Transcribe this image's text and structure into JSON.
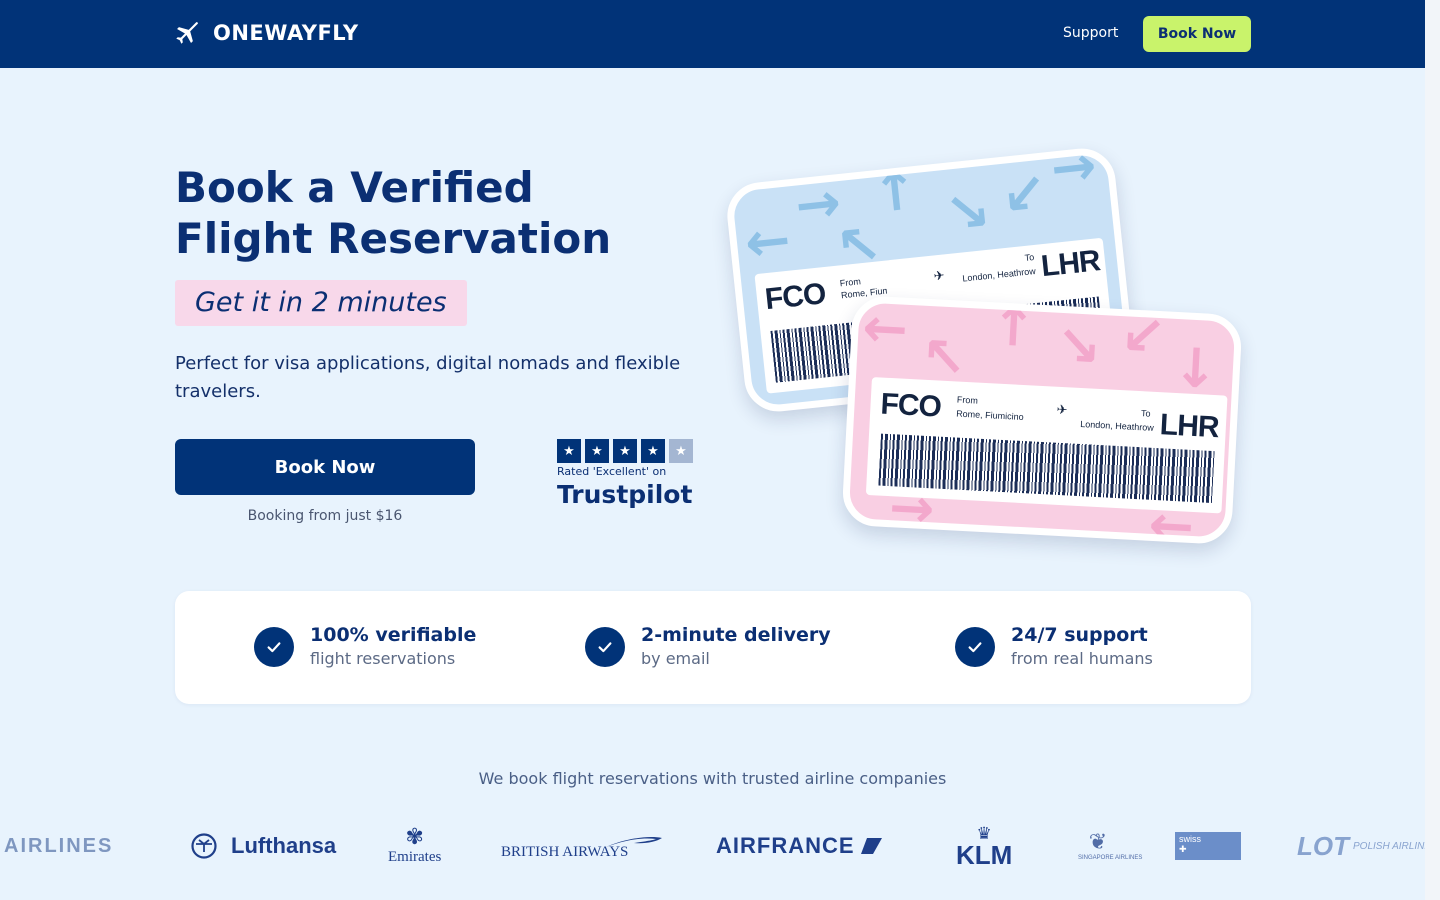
{
  "header": {
    "logo_text": "ONEWAYFLY",
    "nav_support": "Support",
    "nav_book": "Book Now"
  },
  "hero": {
    "title_line1": "Book a Verified",
    "title_line2": "Flight Reservation",
    "highlight": "Get it in 2 minutes",
    "subtitle": "Perfect for visa applications, digital nomads and flexible travelers.",
    "cta_label": "Book Now",
    "cta_note": "Booking from just $16"
  },
  "trustpilot": {
    "rating_filled": 4,
    "rating_total": 5,
    "rated_text": "Rated 'Excellent' on",
    "brand": "Trustpilot"
  },
  "tickets": [
    {
      "from_code": "FCO",
      "from_label": "From",
      "from_city": "Rome, Fiumicino",
      "to_code": "LHR",
      "to_label": "To",
      "to_city": "London, Heathrow",
      "color": "#c9e1f6"
    },
    {
      "from_code": "FCO",
      "from_label": "From",
      "from_city": "Rome, Fiumicino",
      "to_code": "LHR",
      "to_label": "To",
      "to_city": "London, Heathrow",
      "color": "#f9cfe3"
    }
  ],
  "features": [
    {
      "title": "100% verifiable",
      "subtitle": "flight reservations"
    },
    {
      "title": "2-minute delivery",
      "subtitle": "by email"
    },
    {
      "title": "24/7 support",
      "subtitle": "from real humans"
    }
  ],
  "airlines": {
    "title": "We book flight reservations with trusted airline companies",
    "logos": [
      {
        "name": "AIRLINES"
      },
      {
        "name": "Lufthansa"
      },
      {
        "name": "Emirates"
      },
      {
        "name": "BRITISH AIRWAYS"
      },
      {
        "name": "AIRFRANCE"
      },
      {
        "name": "KLM"
      },
      {
        "name": "SINGAPORE AIRLINES"
      },
      {
        "name": "swiss"
      },
      {
        "name": "LOT",
        "sub": "POLISH AIRLINES"
      }
    ]
  },
  "colors": {
    "navy": "#013378",
    "accent_green": "#c9f36b",
    "page_bg": "#e8f3fd",
    "highlight_pink": "#f8d8ea"
  }
}
